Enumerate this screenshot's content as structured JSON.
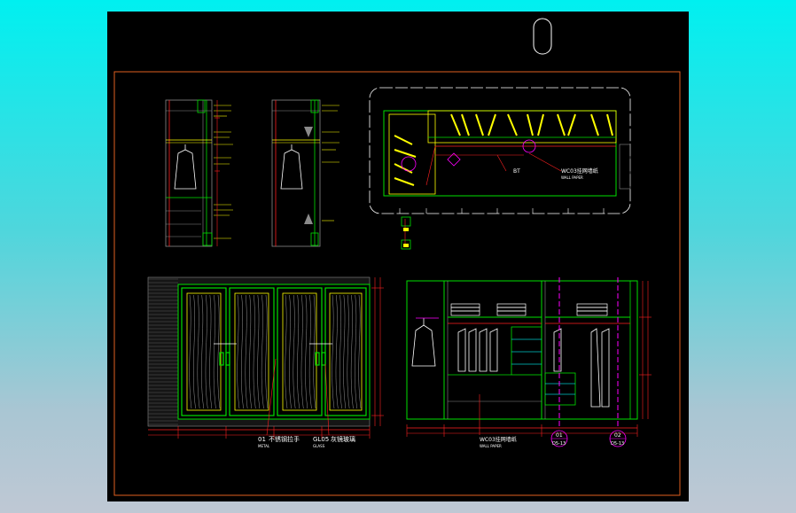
{
  "canvas": {
    "background": "#000000",
    "border_color": "#e06020"
  },
  "colors": {
    "green": "#00e000",
    "yellow": "#ffff00",
    "red": "#ff2020",
    "white": "#ffffff",
    "magenta": "#ff00ff",
    "cyan": "#00c8c8",
    "grey": "#8a8a8a",
    "orange": "#e06020"
  },
  "annotations": {
    "plan_label_1": "BT",
    "plan_label_2": "WC03挂网墙纸",
    "plan_sub_2": "WALL PAPER",
    "door_label_1": "01",
    "door_text_1": "不锈钢拉手",
    "door_sub_1": "METAL",
    "door_label_2": "GL05",
    "door_text_2": "灰镜玻璃",
    "door_sub_2": "GLASS",
    "interior_label": "WC03挂网墙纸",
    "interior_sub": "WALL PAPER",
    "callout_1_top": "01",
    "callout_1_bottom": "D5-13",
    "callout_2_top": "02",
    "callout_2_bottom": "D5-13"
  }
}
